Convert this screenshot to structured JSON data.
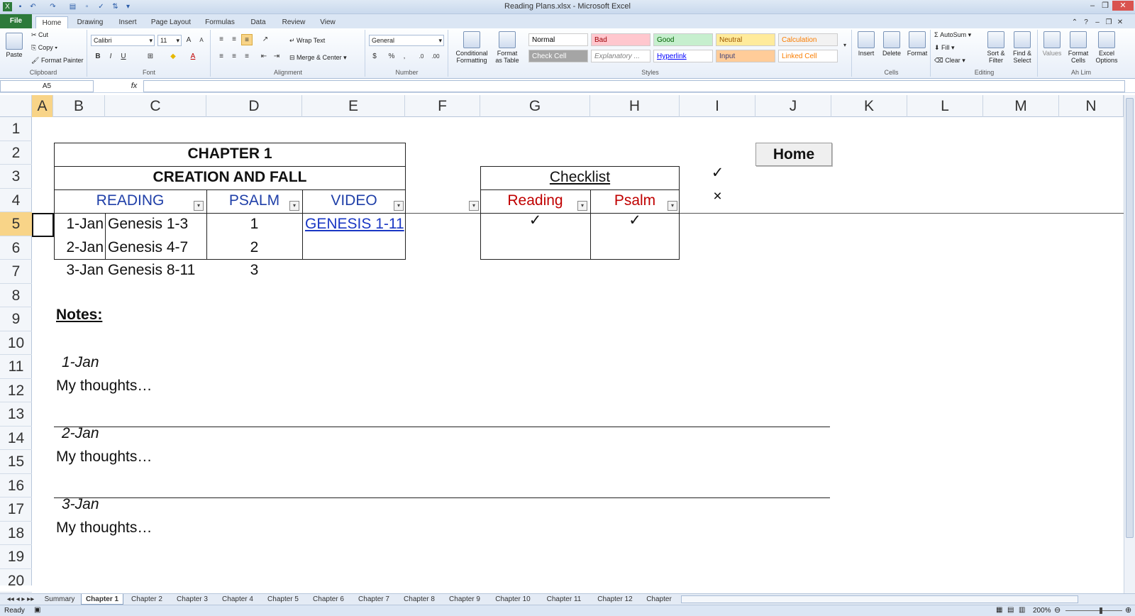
{
  "window": {
    "title": "Reading Plans.xlsx - Microsoft Excel"
  },
  "ribbon_tabs": [
    "File",
    "Home",
    "Drawing",
    "Insert",
    "Page Layout",
    "Formulas",
    "Data",
    "Review",
    "View"
  ],
  "clipboard": {
    "paste": "Paste",
    "cut": "Cut",
    "copy": "Copy",
    "format_painter": "Format Painter",
    "label": "Clipboard"
  },
  "font": {
    "name": "Calibri",
    "size": "11",
    "bold": "B",
    "italic": "I",
    "underline": "U",
    "label": "Font"
  },
  "alignment": {
    "wrap": "Wrap Text",
    "merge": "Merge & Center",
    "label": "Alignment"
  },
  "number": {
    "format": "General",
    "percent": "%",
    "comma": ",",
    "label": "Number"
  },
  "styles": {
    "cond": "Conditional Formatting",
    "table": "Format as Table",
    "label": "Styles",
    "items": [
      {
        "name": "Normal",
        "bg": "#ffffff",
        "fg": "#000000"
      },
      {
        "name": "Bad",
        "bg": "#ffc7ce",
        "fg": "#9c0006"
      },
      {
        "name": "Good",
        "bg": "#c6efce",
        "fg": "#006100"
      },
      {
        "name": "Neutral",
        "bg": "#ffeb9c",
        "fg": "#9c5700"
      },
      {
        "name": "Calculation",
        "bg": "#f2f2f2",
        "fg": "#fa7d00"
      },
      {
        "name": "Check Cell",
        "bg": "#a5a5a5",
        "fg": "#ffffff"
      },
      {
        "name": "Explanatory ...",
        "bg": "#ffffff",
        "fg": "#7f7f7f"
      },
      {
        "name": "Hyperlink",
        "bg": "#ffffff",
        "fg": "#0000ff"
      },
      {
        "name": "Input",
        "bg": "#ffcc99",
        "fg": "#3f3f76"
      },
      {
        "name": "Linked Cell",
        "bg": "#ffffff",
        "fg": "#fa7d00"
      }
    ]
  },
  "cells_group": {
    "insert": "Insert",
    "delete": "Delete",
    "format": "Format",
    "label": "Cells"
  },
  "editing": {
    "autosum": "AutoSum",
    "fill": "Fill",
    "clear": "Clear",
    "sort": "Sort & Filter",
    "find": "Find & Select",
    "label": "Editing"
  },
  "ahlim": {
    "values": "Values",
    "format_cells": "Format Cells",
    "excel_options": "Excel Options",
    "label": "Ah Lim"
  },
  "formula_bar": {
    "name_box": "A5",
    "fx": "fx",
    "formula": ""
  },
  "columns": [
    "A",
    "B",
    "C",
    "D",
    "E",
    "F",
    "G",
    "H",
    "I",
    "J",
    "K",
    "L",
    "M",
    "N"
  ],
  "rows": [
    "1",
    "2",
    "3",
    "4",
    "5",
    "6",
    "7",
    "8",
    "9",
    "10",
    "11",
    "12",
    "13",
    "14",
    "15",
    "16",
    "17",
    "18",
    "19",
    "20"
  ],
  "sheet": {
    "chapter_title": "CHAPTER 1",
    "chapter_subtitle": "CREATION AND FALL",
    "headers": {
      "reading": "READING",
      "psalm": "PSALM",
      "video": "VIDEO"
    },
    "plan": [
      {
        "date": "1-Jan",
        "reading": "Genesis 1-3",
        "psalm": "1",
        "video": "GENESIS 1-11"
      },
      {
        "date": "2-Jan",
        "reading": "Genesis 4-7",
        "psalm": "2",
        "video": ""
      },
      {
        "date": "3-Jan",
        "reading": "Genesis 8-11",
        "psalm": "3",
        "video": ""
      }
    ],
    "checklist": {
      "title": "Checklist",
      "reading": "Reading",
      "psalm": "Psalm",
      "row1_reading": "✓",
      "row1_psalm": "✓"
    },
    "legend": {
      "check": "✓",
      "cross": "×"
    },
    "home_button": "Home",
    "notes_title": "Notes:",
    "notes": [
      {
        "date": "1-Jan",
        "text": "My thoughts…"
      },
      {
        "date": "2-Jan",
        "text": "My thoughts…"
      },
      {
        "date": "3-Jan",
        "text": "My thoughts…"
      }
    ]
  },
  "sheet_tabs": [
    "Summary",
    "Chapter 1",
    "Chapter 2",
    "Chapter 3",
    "Chapter 4",
    "Chapter 5",
    "Chapter 6",
    "Chapter 7",
    "Chapter 8",
    "Chapter 9",
    "Chapter 10",
    "Chapter 11",
    "Chapter 12",
    "Chapter"
  ],
  "status": {
    "ready": "Ready",
    "zoom": "200%"
  },
  "colors": {
    "header_blue": "#1f3fa8",
    "header_red": "#c00000",
    "link": "#1a37c4",
    "select": "#f8d488"
  }
}
